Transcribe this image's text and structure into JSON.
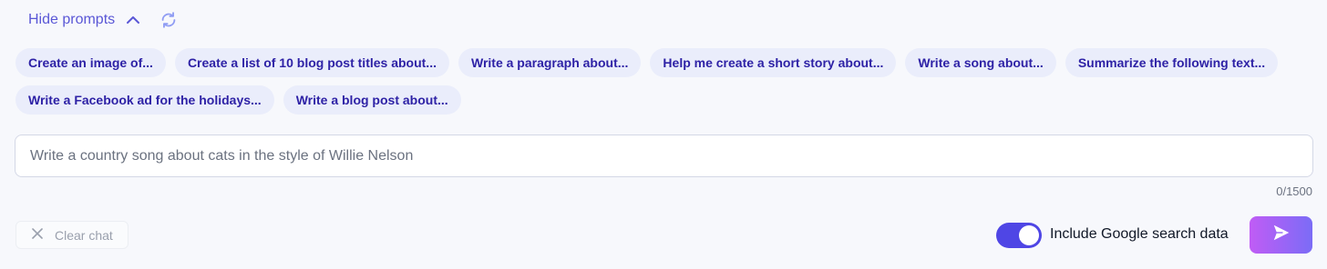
{
  "header": {
    "hide_prompts_label": "Hide prompts"
  },
  "prompts": [
    "Create an image of...",
    "Create a list of 10 blog post titles about...",
    "Write a paragraph about...",
    "Help me create a short story about...",
    "Write a song about...",
    "Summarize the following text...",
    "Write a Facebook ad for the holidays...",
    "Write a blog post about..."
  ],
  "input": {
    "value": "",
    "placeholder": "Write a country song about cats in the style of Willie Nelson",
    "counter": "0/1500"
  },
  "footer": {
    "clear_chat_label": "Clear chat",
    "toggle_label": "Include Google search data",
    "toggle_on": true
  },
  "colors": {
    "accent": "#4f46e5",
    "chip_bg": "#eaedfb",
    "chip_text": "#2e22a6",
    "link": "#5a57d6",
    "send_gradient_start": "#c05cf5",
    "send_gradient_end": "#7b6cf6"
  },
  "icons": {
    "collapse": "chevron-up-icon",
    "refresh": "refresh-icon",
    "clear": "close-icon",
    "send": "send-icon"
  }
}
